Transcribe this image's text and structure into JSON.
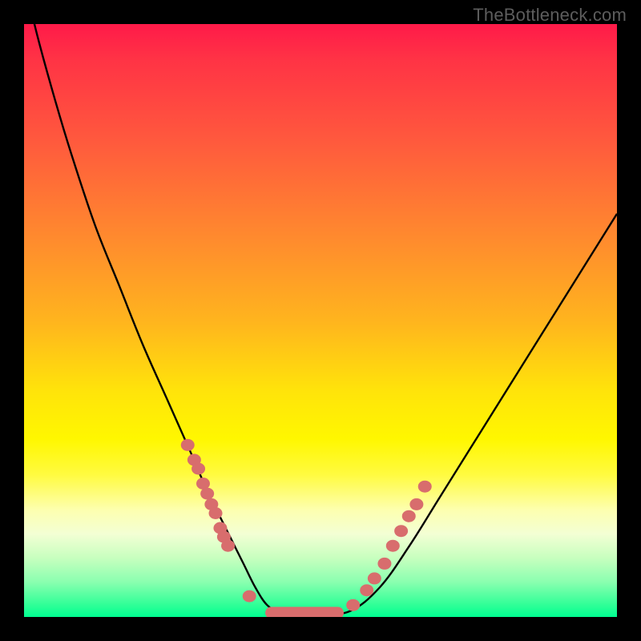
{
  "watermark": "TheBottleneck.com",
  "colors": {
    "gradient_top": "#ff1a49",
    "gradient_mid": "#ffe40a",
    "gradient_bottom": "#00ff91",
    "curve": "#000000",
    "marker_fill": "#d86d6d",
    "frame": "#000000"
  },
  "chart_data": {
    "type": "line",
    "title": "",
    "xlabel": "",
    "ylabel": "",
    "xlim": [
      0,
      100
    ],
    "ylim": [
      0,
      100
    ],
    "grid": false,
    "x": [
      0,
      2,
      5,
      8,
      12,
      16,
      20,
      24,
      28,
      31,
      33,
      35,
      37,
      39,
      41,
      43,
      46,
      50,
      55,
      60,
      65,
      70,
      75,
      80,
      85,
      90,
      95,
      100
    ],
    "y": [
      108,
      99,
      88,
      78,
      66,
      56,
      46,
      37,
      28,
      21,
      17,
      13,
      9,
      5,
      2,
      1,
      0.5,
      0.5,
      1,
      5,
      12,
      20,
      28,
      36,
      44,
      52,
      60,
      68
    ],
    "markers_left": {
      "x": [
        27.6,
        28.7,
        29.4,
        30.2,
        30.9,
        31.6,
        32.3,
        33.1,
        33.7,
        34.4,
        38.0
      ],
      "y": [
        29.0,
        26.5,
        25.0,
        22.5,
        20.8,
        19.0,
        17.5,
        15.0,
        13.5,
        12.0,
        3.5
      ]
    },
    "markers_right": {
      "x": [
        55.5,
        57.8,
        59.1,
        60.8,
        62.2,
        63.6,
        64.9,
        66.2,
        67.6
      ],
      "y": [
        2.0,
        4.5,
        6.5,
        9.0,
        12.0,
        14.5,
        17.0,
        19.0,
        22.0
      ]
    },
    "markers_bottom": {
      "x": [
        41.9,
        43.2,
        44.6,
        45.9,
        47.3,
        48.6,
        50.0,
        51.4,
        52.7
      ],
      "y": [
        0.7,
        0.7,
        0.7,
        0.7,
        0.7,
        0.7,
        0.7,
        0.7,
        0.7
      ]
    }
  }
}
